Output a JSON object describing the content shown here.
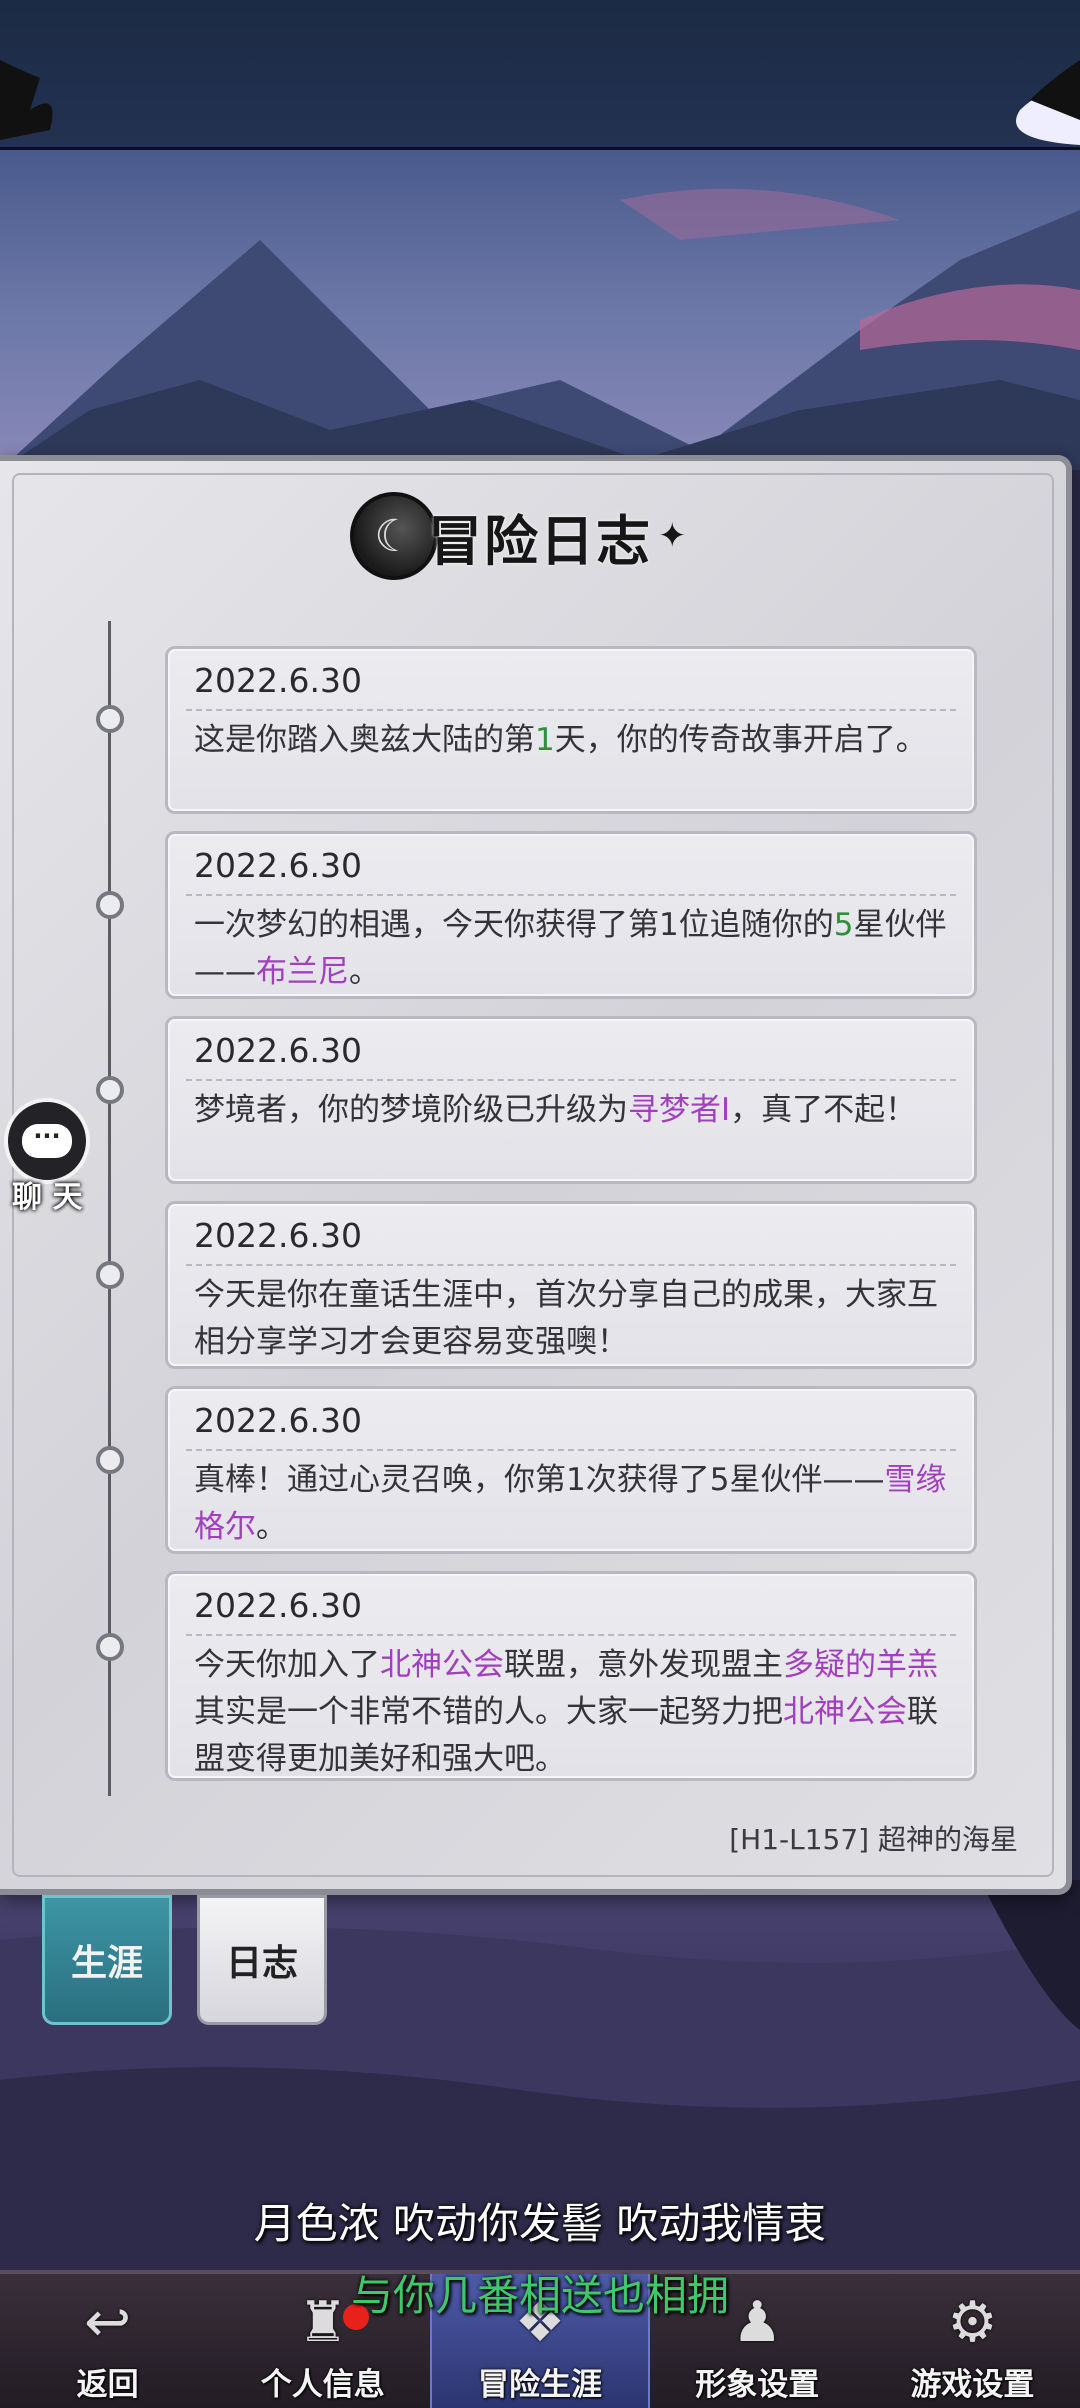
{
  "journal": {
    "title": "冒险日志",
    "signature": "[H1-L157] 超神的海星",
    "entries": [
      {
        "date": "2022.6.30",
        "parts": [
          {
            "t": "这是你踏入奥兹大陆的第",
            "c": ""
          },
          {
            "t": "1",
            "c": "green"
          },
          {
            "t": "天，你的传奇故事开启了。",
            "c": ""
          }
        ]
      },
      {
        "date": "2022.6.30",
        "parts": [
          {
            "t": "一次梦幻的相遇，今天你获得了第1位追随你的",
            "c": ""
          },
          {
            "t": "5",
            "c": "green"
          },
          {
            "t": "星伙伴——",
            "c": ""
          },
          {
            "t": "布兰尼",
            "c": "purple"
          },
          {
            "t": "。",
            "c": ""
          }
        ]
      },
      {
        "date": "2022.6.30",
        "parts": [
          {
            "t": "梦境者，你的梦境阶级已升级为",
            "c": ""
          },
          {
            "t": "寻梦者Ⅰ",
            "c": "purple"
          },
          {
            "t": "，真了不起！",
            "c": ""
          }
        ]
      },
      {
        "date": "2022.6.30",
        "parts": [
          {
            "t": "今天是你在童话生涯中，首次分享自己的成果，大家互相分享学习才会更容易变强噢！",
            "c": ""
          }
        ]
      },
      {
        "date": "2022.6.30",
        "parts": [
          {
            "t": "真棒！通过心灵召唤，你第1次获得了5星伙伴——",
            "c": ""
          },
          {
            "t": "雪缘格尔",
            "c": "purple"
          },
          {
            "t": "。",
            "c": ""
          }
        ]
      },
      {
        "date": "2022.6.30",
        "parts": [
          {
            "t": "今天你加入了",
            "c": ""
          },
          {
            "t": "北神公会",
            "c": "purple"
          },
          {
            "t": "联盟，意外发现盟主",
            "c": ""
          },
          {
            "t": "多疑的羊羔",
            "c": "purple"
          },
          {
            "t": "其实是一个非常不错的人。大家一起努力把",
            "c": ""
          },
          {
            "t": "北神公会",
            "c": "purple"
          },
          {
            "t": "联盟变得更加美好和强大吧。",
            "c": ""
          }
        ]
      }
    ]
  },
  "tabs": {
    "career": "生涯",
    "log": "日志"
  },
  "chat": {
    "label": "聊 天"
  },
  "lyrics": {
    "line1": "月色浓 吹动你发髻 吹动我情衷",
    "line2": "与你几番相送也相拥"
  },
  "nav": [
    {
      "label": "返回",
      "icon": "back-arrow-icon"
    },
    {
      "label": "个人信息",
      "icon": "castle-icon"
    },
    {
      "label": "冒险生涯",
      "icon": "emblem-icon"
    },
    {
      "label": "形象设置",
      "icon": "hooded-figure-icon"
    },
    {
      "label": "游戏设置",
      "icon": "gear-icon"
    }
  ],
  "colors": {
    "highlight_green": "#2f8f3a",
    "highlight_purple": "#a23fbf",
    "active_tab": "#3e95a4",
    "badge": "#e8211b"
  }
}
